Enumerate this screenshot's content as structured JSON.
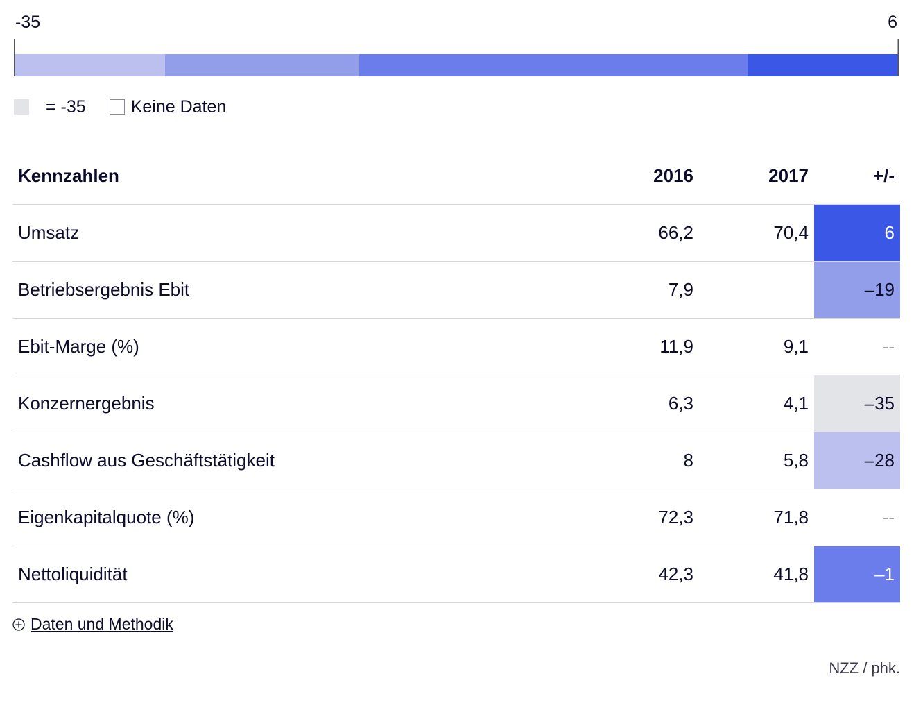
{
  "scale": {
    "min_label": "-35",
    "max_label": "6",
    "min": -35,
    "max": 6,
    "segments": [
      {
        "from": -35,
        "to": -28,
        "color": "#bcc0ee"
      },
      {
        "from": -28,
        "to": -19,
        "color": "#939eea"
      },
      {
        "from": -19,
        "to": -1,
        "color": "#6a7deb"
      },
      {
        "from": -1,
        "to": 6,
        "color": "#3b57e6"
      }
    ]
  },
  "legend": {
    "min_text": "= -35",
    "nodata_text": "Keine Daten"
  },
  "chart_data": {
    "type": "table",
    "columns": [
      "Kennzahlen",
      "2016",
      "2017",
      "+/-"
    ],
    "rows": [
      {
        "label": "Umsatz",
        "y2016": "66,2",
        "y2017": "70,4",
        "change": "6",
        "change_value": 6,
        "color": "#3b57e6",
        "text_color": "#ffffff"
      },
      {
        "label": "Betriebsergebnis Ebit",
        "y2016": "7,9",
        "y2017": "",
        "change": "–19",
        "change_value": -19,
        "color": "#939eea",
        "text_color": "#0d0d2b"
      },
      {
        "label": "Ebit-Marge (%)",
        "y2016": "11,9",
        "y2017": "9,1",
        "change": "--",
        "change_value": null,
        "color": "#ffffff",
        "text_color": "#a0a0a8"
      },
      {
        "label": "Konzernergebnis",
        "y2016": "6,3",
        "y2017": "4,1",
        "change": "–35",
        "change_value": -35,
        "color": "#e3e4e8",
        "text_color": "#0d0d2b"
      },
      {
        "label": "Cashflow aus Geschäftstätigkeit",
        "y2016": "8",
        "y2017": "5,8",
        "change": "–28",
        "change_value": -28,
        "color": "#bcc0ee",
        "text_color": "#0d0d2b"
      },
      {
        "label": "Eigenkapitalquote (%)",
        "y2016": "72,3",
        "y2017": "71,8",
        "change": "--",
        "change_value": null,
        "color": "#ffffff",
        "text_color": "#a0a0a8"
      },
      {
        "label": "Nettoliquidität",
        "y2016": "42,3",
        "y2017": "41,8",
        "change": "–1",
        "change_value": -1,
        "color": "#6a7deb",
        "text_color": "#ffffff"
      }
    ]
  },
  "footer": {
    "methodik_label": "Daten und Methodik",
    "source": "NZZ / phk."
  }
}
